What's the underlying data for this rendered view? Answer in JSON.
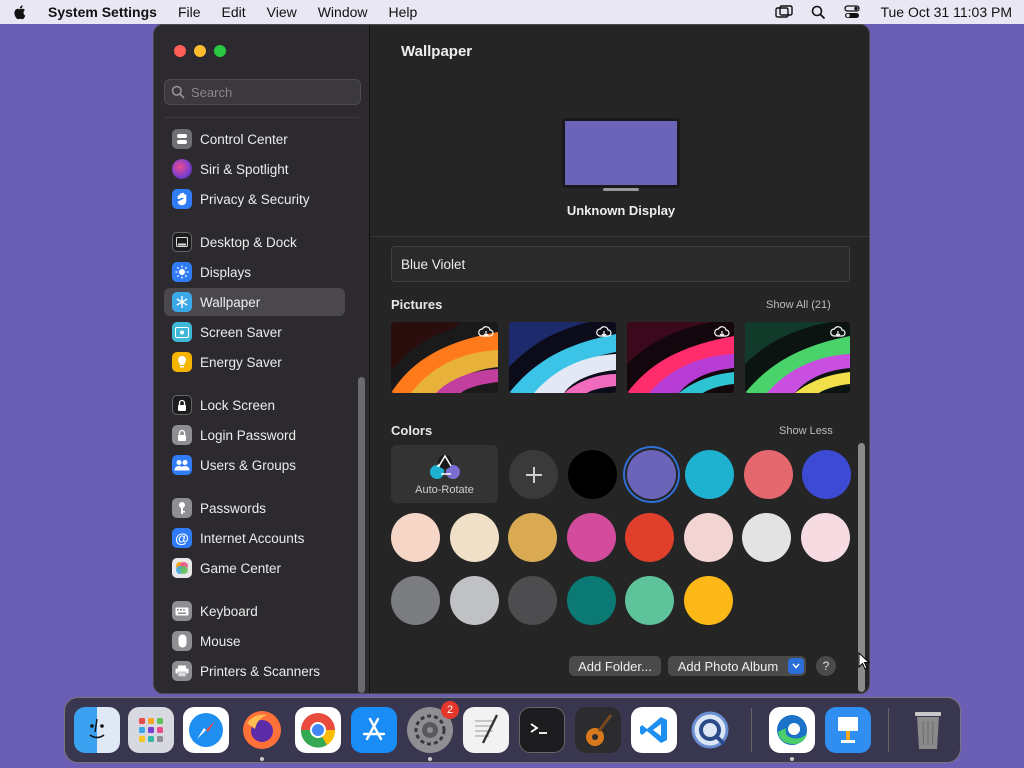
{
  "menubar": {
    "app_name": "System Settings",
    "items": [
      "File",
      "Edit",
      "View",
      "Window",
      "Help"
    ],
    "clock": "Tue Oct 31  11:03 PM"
  },
  "sidebar": {
    "search_placeholder": "Search",
    "items": [
      {
        "label": "Control Center",
        "icon": "control-center-icon",
        "color": "#6e6e73"
      },
      {
        "label": "Siri & Spotlight",
        "icon": "siri-icon",
        "color": "#7a3fd1"
      },
      {
        "label": "Privacy & Security",
        "icon": "hand-icon",
        "color": "#2f7cf6"
      },
      {
        "label": "Desktop & Dock",
        "icon": "dock-icon",
        "color": "#1c1c1e"
      },
      {
        "label": "Displays",
        "icon": "sun-icon",
        "color": "#2f7cf6"
      },
      {
        "label": "Wallpaper",
        "icon": "snowflake-icon",
        "color": "#3aa7e6",
        "selected": true
      },
      {
        "label": "Screen Saver",
        "icon": "screensaver-icon",
        "color": "#3fb8d8"
      },
      {
        "label": "Energy Saver",
        "icon": "bulb-icon",
        "color": "#f4b400"
      },
      {
        "label": "Lock Screen",
        "icon": "lock-icon",
        "color": "#1c1c1e"
      },
      {
        "label": "Login Password",
        "icon": "lock-small-icon",
        "color": "#8e8e93"
      },
      {
        "label": "Users & Groups",
        "icon": "users-icon",
        "color": "#2f7cf6"
      },
      {
        "label": "Passwords",
        "icon": "key-icon",
        "color": "#8e8e93"
      },
      {
        "label": "Internet Accounts",
        "icon": "at-icon",
        "color": "#2f7cf6"
      },
      {
        "label": "Game Center",
        "icon": "game-center-icon",
        "color": "#e9e9e9"
      },
      {
        "label": "Keyboard",
        "icon": "keyboard-icon",
        "color": "#8e8e93"
      },
      {
        "label": "Mouse",
        "icon": "mouse-icon",
        "color": "#8e8e93"
      },
      {
        "label": "Printers & Scanners",
        "icon": "printer-icon",
        "color": "#8e8e93"
      }
    ]
  },
  "main": {
    "title": "Wallpaper",
    "display_name": "Unknown Display",
    "wallpaper_name": "Blue Violet",
    "pictures_header": "Pictures",
    "pictures_link": "Show All (21)",
    "colors_header": "Colors",
    "colors_link": "Show Less",
    "auto_rotate_label": "Auto-Rotate",
    "add_folder_label": "Add Folder...",
    "add_album_label": "Add Photo Album",
    "help_label": "?",
    "colors_row1": [
      "#000000",
      "#6b64b8",
      "#1eb1d0",
      "#e5686f",
      "#3d4bd4"
    ],
    "colors_row2": [
      "#f6d6c6",
      "#f1e0c8",
      "#d9aa52",
      "#d34b9c",
      "#e0402b",
      "#f2d5d3",
      "#e3e3e3",
      "#f7dbe3"
    ],
    "colors_row3": [
      "#7b7c80",
      "#c0c1c4",
      "#4d4d4f",
      "#0b7a74",
      "#5ec39a",
      "#fbb817"
    ],
    "selected_color": "#6b64b8"
  },
  "dock": {
    "apps": [
      {
        "name": "Finder",
        "icon": "finder-icon",
        "color": "#3aa0f0"
      },
      {
        "name": "Launchpad",
        "icon": "launchpad-icon",
        "color": "#d8d8e0"
      },
      {
        "name": "Safari",
        "icon": "safari-icon",
        "color": "#1f8ef1"
      },
      {
        "name": "Firefox",
        "icon": "firefox-icon",
        "color": "#ff7139"
      },
      {
        "name": "Chrome",
        "icon": "chrome-icon",
        "color": "#ffffff"
      },
      {
        "name": "App Store",
        "icon": "app-store-icon",
        "color": "#1a8cf5"
      },
      {
        "name": "System Settings",
        "icon": "settings-icon",
        "color": "#8e8e93",
        "badge": "2"
      },
      {
        "name": "TextEdit",
        "icon": "textedit-icon",
        "color": "#f2f2f2"
      },
      {
        "name": "Terminal",
        "icon": "terminal-icon",
        "color": "#1c1c1e"
      },
      {
        "name": "GarageBand",
        "icon": "guitar-icon",
        "color": "#2c2c2e"
      },
      {
        "name": "VS Code",
        "icon": "vscode-icon",
        "color": "#ffffff"
      },
      {
        "name": "QuickTime",
        "icon": "quicktime-icon",
        "color": "#6a8fd0"
      },
      {
        "name": "Edge",
        "icon": "edge-icon",
        "color": "#ffffff"
      },
      {
        "name": "Keynote",
        "icon": "keynote-icon",
        "color": "#2f8ef0"
      },
      {
        "name": "Trash",
        "icon": "trash-icon",
        "color": "#9a9a9a"
      }
    ]
  }
}
